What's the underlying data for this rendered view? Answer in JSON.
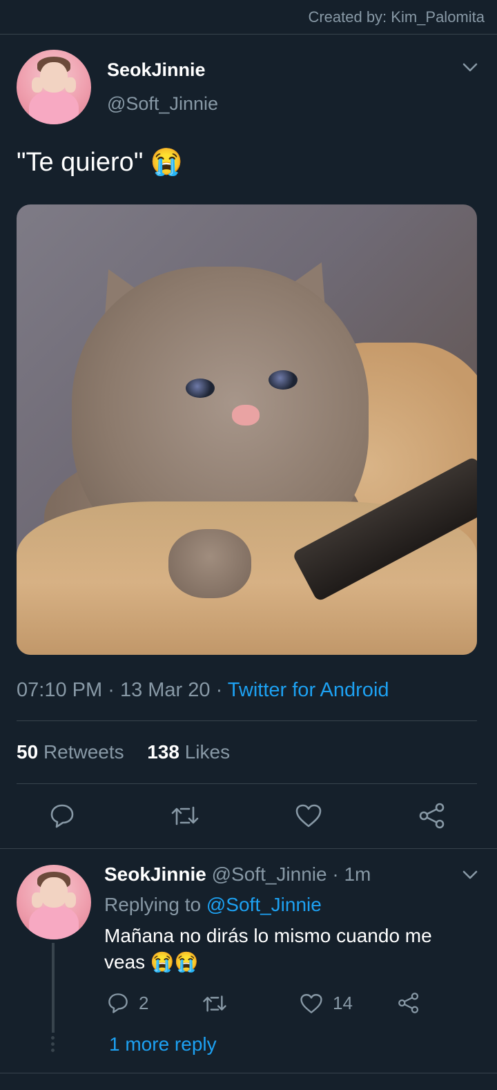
{
  "credit": "Created by: Kim_Palomita",
  "tweet": {
    "name": "SeokJinnie",
    "handle": "@Soft_Jinnie",
    "text": "\"Te quiero\" 😭",
    "time": "07:10 PM",
    "sep1": "·",
    "date": "13 Mar 20",
    "sep2": "·",
    "client": "Twitter for Android",
    "retweets_count": "50",
    "retweets_label": "Retweets",
    "likes_count": "138",
    "likes_label": "Likes"
  },
  "reply": {
    "name": "SeokJinnie",
    "handle": "@Soft_Jinnie",
    "dot": "·",
    "time": "1m",
    "replying_label": "Replying to",
    "replying_handle": "@Soft_Jinnie",
    "text": "Mañana no dirás lo mismo cuando me veas 😭😭",
    "reply_count": "2",
    "like_count": "14",
    "more_replies": "1 more reply"
  },
  "icons": {
    "chevron": "chevron-down-icon",
    "reply": "reply-icon",
    "retweet": "retweet-icon",
    "like": "heart-icon",
    "share": "share-icon"
  },
  "colors": {
    "background": "#15202b",
    "muted": "#8899a6",
    "link": "#1da1f2",
    "divider": "#38444d"
  }
}
